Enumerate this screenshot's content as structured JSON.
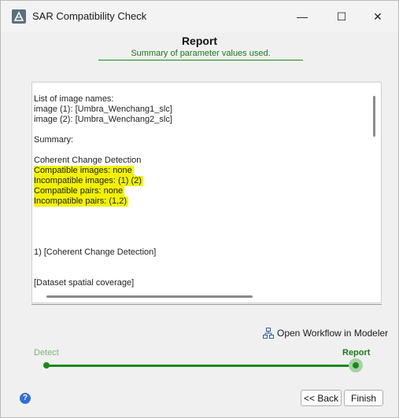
{
  "window": {
    "title": "SAR Compatibility Check"
  },
  "titlebar_controls": {
    "minimize": "—",
    "maximize": "☐",
    "close": "✕"
  },
  "header": {
    "title": "Report",
    "subtitle": "Summary of parameter values used."
  },
  "report": {
    "lines": [
      {
        "text": "List of image names:",
        "highlight": false
      },
      {
        "text": "image (1): [Umbra_Wenchang1_slc]",
        "highlight": false
      },
      {
        "text": "image (2): [Umbra_Wenchang2_slc]",
        "highlight": false
      },
      {
        "text": "",
        "highlight": false
      },
      {
        "text": "Summary:",
        "highlight": false
      },
      {
        "text": "",
        "highlight": false
      },
      {
        "text": "Coherent Change Detection",
        "highlight": false
      },
      {
        "text": "Compatible images: none",
        "highlight": true
      },
      {
        "text": "Incompatible images: (1) (2)",
        "highlight": true
      },
      {
        "text": "Compatible pairs: none",
        "highlight": true
      },
      {
        "text": "Incompatible pairs: (1,2)",
        "highlight": true
      },
      {
        "text": "",
        "highlight": false
      },
      {
        "text": "",
        "highlight": false
      },
      {
        "text": "",
        "highlight": false
      },
      {
        "text": "",
        "highlight": false
      },
      {
        "text": "1) [Coherent Change Detection]",
        "highlight": false
      },
      {
        "text": "",
        "highlight": false
      },
      {
        "text": "",
        "highlight": false
      },
      {
        "text": "[Dataset spatial coverage]",
        "highlight": false
      }
    ]
  },
  "workflow_link": {
    "label": "Open Workflow in Modeler",
    "icon": "workflow-icon"
  },
  "progress": {
    "steps": [
      "Detect",
      "Report"
    ],
    "current": "Report"
  },
  "buttons": {
    "back": "<< Back",
    "finish": "Finish",
    "help": "?"
  },
  "colors": {
    "accent_green": "#1a8a1a",
    "highlight": "#f2f200"
  }
}
